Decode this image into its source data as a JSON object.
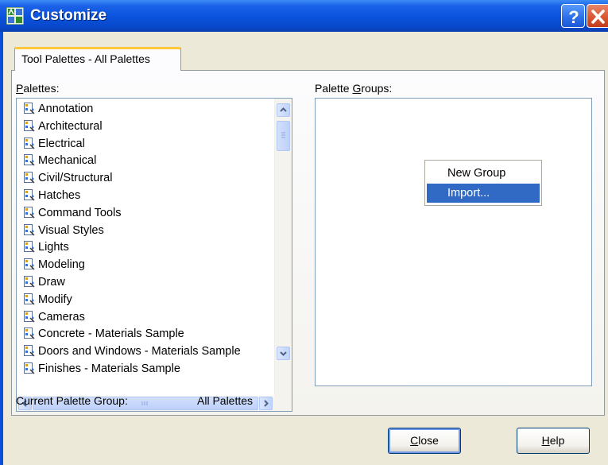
{
  "window": {
    "title": "Customize"
  },
  "tab": {
    "label": "Tool Palettes - All Palettes"
  },
  "palettes": {
    "label_prefix": "",
    "label_mnemonic": "P",
    "label_rest": "alettes:",
    "items": [
      "Annotation",
      "Architectural",
      "Electrical",
      "Mechanical",
      "Civil/Structural",
      "Hatches",
      "Command Tools",
      "Visual Styles",
      "Lights",
      "Modeling",
      "Draw",
      "Modify",
      "Cameras",
      "Concrete - Materials Sample",
      "Doors and Windows - Materials Sample",
      "Finishes - Materials Sample"
    ]
  },
  "groups": {
    "label_prefix": "Palette ",
    "label_mnemonic": "G",
    "label_rest": "roups:"
  },
  "context_menu": {
    "items": [
      "New Group",
      "Import..."
    ],
    "selected": "Import..."
  },
  "status": {
    "label": "Current Palette Group:",
    "value": "All Palettes"
  },
  "buttons": {
    "close_mnemonic": "C",
    "close_rest": "lose",
    "help_mnemonic": "H",
    "help_rest": "elp"
  },
  "colors": {
    "titlebar": "#0a52dc",
    "selection": "#316ac5",
    "face": "#ece9d8"
  }
}
